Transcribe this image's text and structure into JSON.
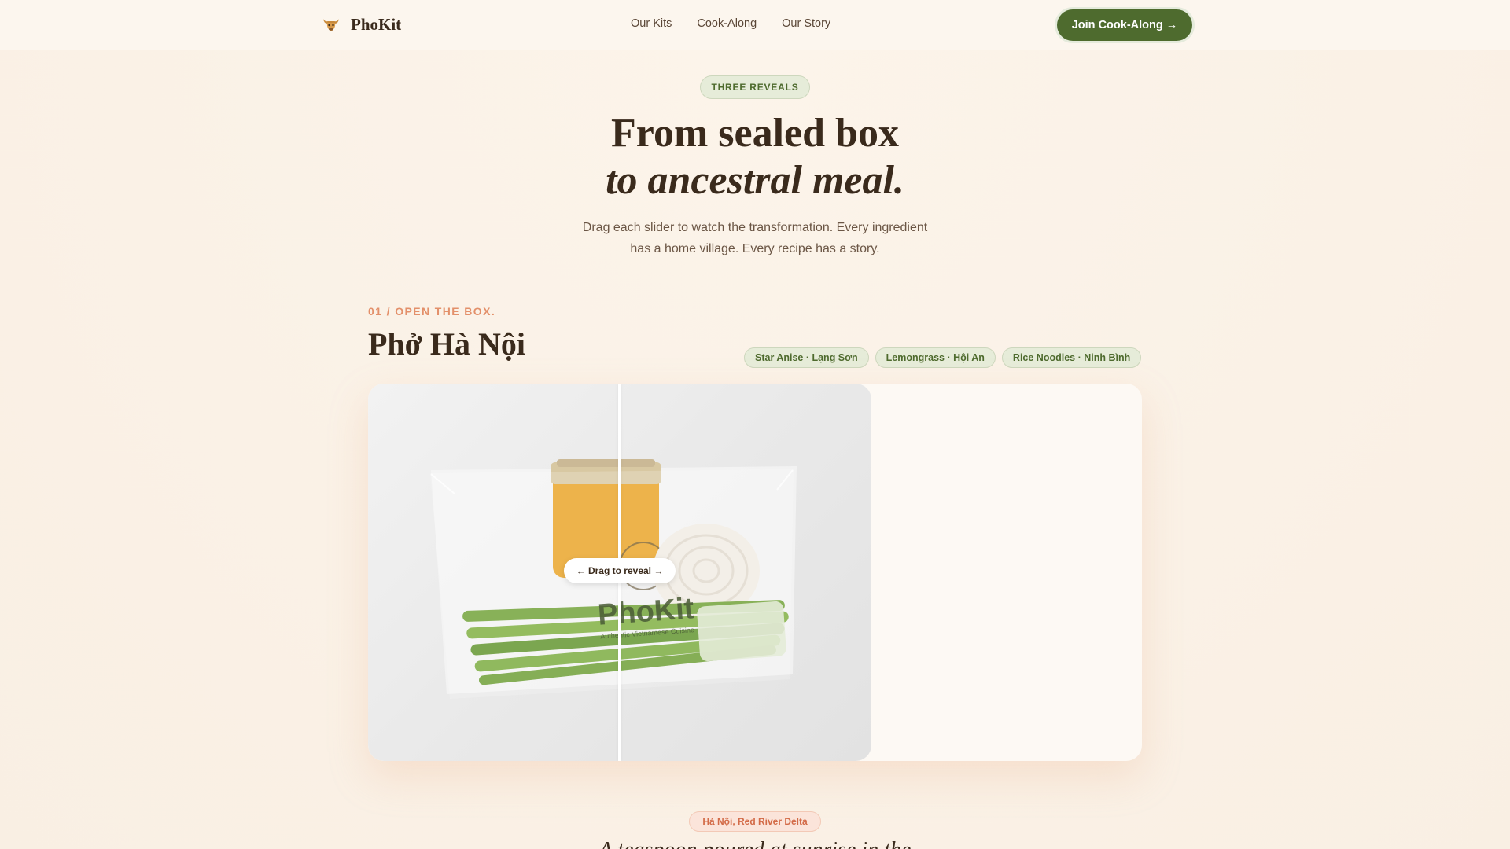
{
  "header": {
    "brand": "PhoKit",
    "nav": [
      "Our Kits",
      "Cook-Along",
      "Our Story"
    ],
    "cta": "Join Cook-Along →"
  },
  "hero": {
    "badge": "THREE REVEALS",
    "title_line1": "From sealed box",
    "title_line2": "to ancestral meal.",
    "subtitle_line1": "Drag each slider to watch the transformation. Every ingredient",
    "subtitle_line2": "has a home village. Every recipe has a story."
  },
  "section": {
    "kicker": "01 / OPEN THE BOX.",
    "title": "Phở Hà Nội",
    "chips": [
      "Star Anise · Lạng Sơn",
      "Lemongrass · Hội An",
      "Rice Noodles · Ninh Bình"
    ],
    "slider_label": "← Drag to reveal →",
    "slider_position": 0.5,
    "photo_brand": "PhoKit",
    "photo_tagline": "Authentic Vietnamese Cuisine"
  },
  "next": {
    "region": "Hà Nội, Red River Delta",
    "line": "A teaspoon poured at sunrise in the"
  },
  "colors": {
    "accent_green": "#4e6b2e",
    "accent_coral": "#e3906a",
    "background": "#faf1e6"
  }
}
